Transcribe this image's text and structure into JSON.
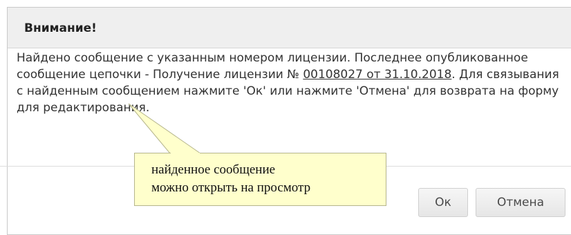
{
  "dialog": {
    "title": "Внимание!",
    "message_part1": "Найдено сообщение с указанным номером лицензии. Последнее опубликованное сообщение цепочки - Получение лицензии № ",
    "message_link": "00108027 от 31.10.2018",
    "message_part2": ". Для связывания с найденным сообщением нажмите 'Ок' или нажмите 'Отмена' для возврата на форму для редактирования.",
    "ok_label": "Ок",
    "cancel_label": "Отмена"
  },
  "callout": {
    "line1": "найденное сообщение",
    "line2": "можно открыть на просмотр"
  },
  "colors": {
    "header_bg": "#efefef",
    "callout_bg": "#ffffcc",
    "text": "#333333"
  }
}
